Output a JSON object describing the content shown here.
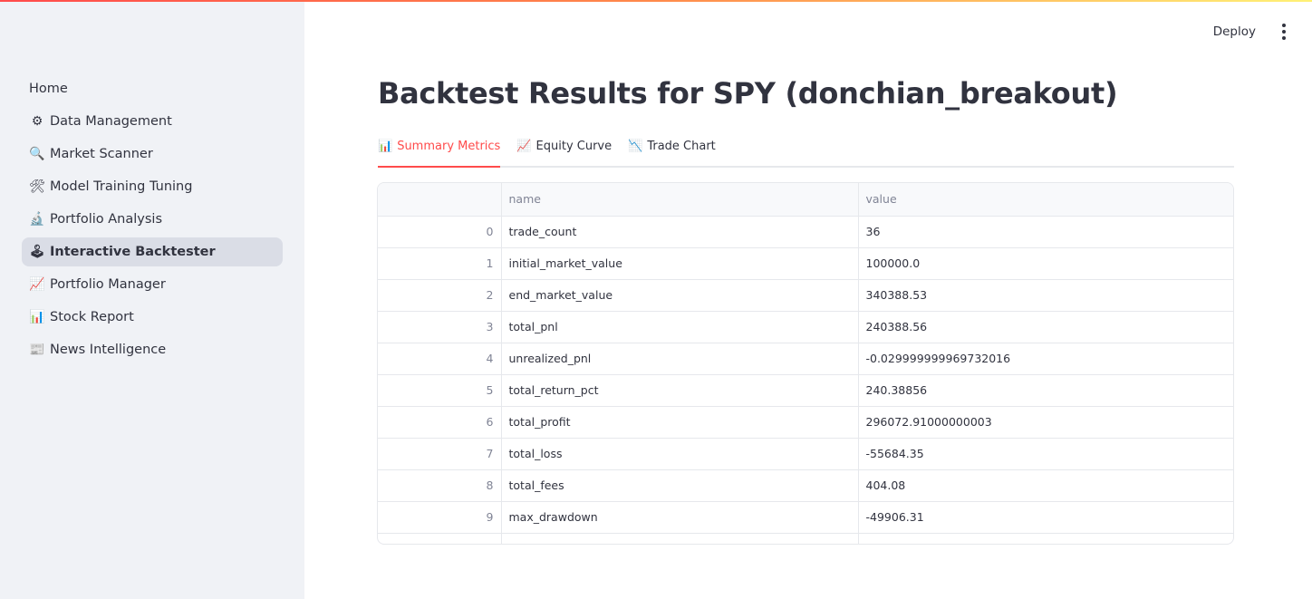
{
  "header": {
    "deploy_label": "Deploy",
    "menu_icon": "kebab-menu-icon"
  },
  "sidebar": {
    "items": [
      {
        "label": "Home",
        "icon": "",
        "active": false
      },
      {
        "label": "Data Management",
        "icon": "⚙",
        "active": false
      },
      {
        "label": "Market Scanner",
        "icon": "🔍",
        "active": false
      },
      {
        "label": "Model Training Tuning",
        "icon": "🛠",
        "active": false
      },
      {
        "label": "Portfolio Analysis",
        "icon": "🔬",
        "active": false
      },
      {
        "label": "Interactive Backtester",
        "icon": "🕹",
        "active": true
      },
      {
        "label": "Portfolio Manager",
        "icon": "📈",
        "active": false
      },
      {
        "label": "Stock Report",
        "icon": "📊",
        "active": false
      },
      {
        "label": "News Intelligence",
        "icon": "📰",
        "active": false
      }
    ]
  },
  "main": {
    "title": "Backtest Results for SPY (donchian_breakout)",
    "tabs": [
      {
        "label": "Summary Metrics",
        "icon": "📊",
        "active": true
      },
      {
        "label": "Equity Curve",
        "icon": "📈",
        "active": false
      },
      {
        "label": "Trade Chart",
        "icon": "📉",
        "active": false
      }
    ],
    "table": {
      "columns": [
        "",
        "name",
        "value"
      ],
      "rows": [
        {
          "index": "0",
          "name": "trade_count",
          "value": "36"
        },
        {
          "index": "1",
          "name": "initial_market_value",
          "value": "100000.0"
        },
        {
          "index": "2",
          "name": "end_market_value",
          "value": "340388.53"
        },
        {
          "index": "3",
          "name": "total_pnl",
          "value": "240388.56"
        },
        {
          "index": "4",
          "name": "unrealized_pnl",
          "value": "-0.029999999969732016"
        },
        {
          "index": "5",
          "name": "total_return_pct",
          "value": "240.38856"
        },
        {
          "index": "6",
          "name": "total_profit",
          "value": "296072.91000000003"
        },
        {
          "index": "7",
          "name": "total_loss",
          "value": "-55684.35"
        },
        {
          "index": "8",
          "name": "total_fees",
          "value": "404.08"
        },
        {
          "index": "9",
          "name": "max_drawdown",
          "value": "-49906.31"
        }
      ]
    }
  },
  "colors": {
    "accent": "#ff4b4b",
    "sidebar_bg": "#f0f2f6",
    "active_nav_bg": "#dadde6"
  }
}
